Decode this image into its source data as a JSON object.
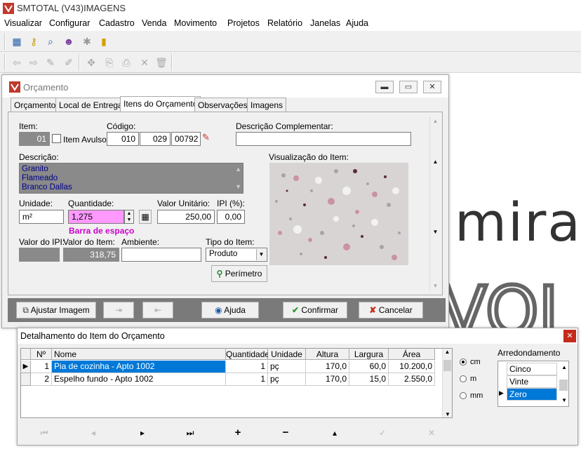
{
  "app": {
    "title": "SMTOTAL (V43)IMAGENS"
  },
  "menu": [
    "Visualizar",
    "Configurar",
    "Cadastro",
    "Venda",
    "Movimento",
    "Projetos",
    "Relatório",
    "Janelas",
    "Ajuda"
  ],
  "background_text": {
    "line1": "mirar",
    "line2": "VOI"
  },
  "orcamento": {
    "title": "Orçamento",
    "tabs": [
      "Orçamento",
      "Local de Entrega",
      "Itens do Orçamento",
      "Observações",
      "Imagens"
    ],
    "active_tab": "Itens do Orçamento",
    "item_label": "Item:",
    "item_value": "01",
    "item_avulso_label": "Item Avulso?",
    "codigo_label": "Código:",
    "codigo_values": [
      "010",
      "029",
      "00792"
    ],
    "desc_comp_label": "Descrição Complementar:",
    "desc_comp_value": "",
    "descricao_label": "Descrição:",
    "descricao_lines": [
      "Granito",
      "Flameado",
      "Branco Dallas"
    ],
    "visualizacao_label": "Visualização do Item:",
    "unidade_label": "Unidade:",
    "unidade_value": "m²",
    "quantidade_label": "Quantidade:",
    "quantidade_value": "1,275",
    "hint": "Barra de espaço",
    "valor_unitario_label": "Valor Unitário:",
    "valor_unitario_value": "250,00",
    "ipi_label": "IPI (%):",
    "ipi_value": "0,00",
    "valor_ipi_label": "Valor do IPI:",
    "valor_ipi_value": "",
    "valor_item_label": "Valor do Item:",
    "valor_item_value": "318,75",
    "ambiente_label": "Ambiente:",
    "ambiente_value": "",
    "tipo_item_label": "Tipo do Item:",
    "tipo_item_value": "Produto",
    "perimetro_label": "Perímetro",
    "buttons": {
      "ajustar": "Ajustar Imagem",
      "ajuda": "Ajuda",
      "confirmar": "Confirmar",
      "cancelar": "Cancelar"
    },
    "colors": {
      "hint": "#cc00cc",
      "quantity_bg": "#ff99ff",
      "description_bg": "#8a8a8a",
      "description_text": "#00008b"
    }
  },
  "detalhamento": {
    "title": "Detalhamento do Item do Orçamento",
    "columns": [
      "Nº",
      "Nome",
      "Quantidade",
      "Unidade",
      "Altura",
      "Largura",
      "Área"
    ],
    "rows": [
      {
        "n": "1",
        "nome": "Pia de cozinha - Apto 1002",
        "quantidade": "1",
        "unidade": "pç",
        "altura": "170,0",
        "largura": "60,0",
        "area": "10.200,0"
      },
      {
        "n": "2",
        "nome": "Espelho fundo - Apto 1002",
        "quantidade": "1",
        "unidade": "pç",
        "altura": "170,0",
        "largura": "15,0",
        "area": "2.550,0"
      }
    ],
    "units": [
      "cm",
      "m",
      "mm"
    ],
    "selected_unit": "cm",
    "arredondamento_label": "Arredondamento",
    "arredondamento_options": [
      "Cinco",
      "Vinte",
      "Zero"
    ],
    "arredondamento_selected": "Zero"
  }
}
